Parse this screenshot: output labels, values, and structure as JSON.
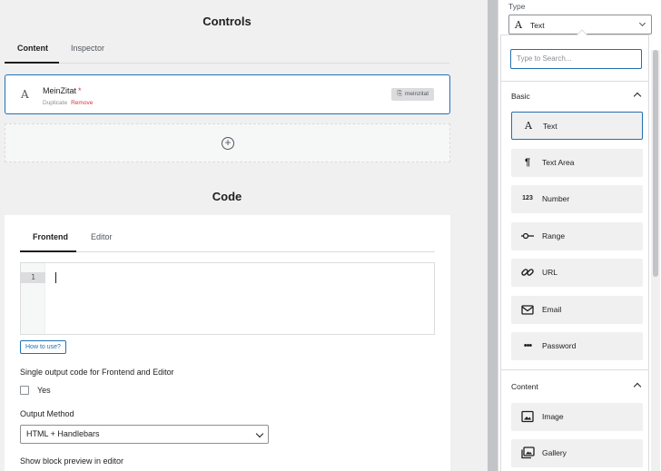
{
  "controls": {
    "title": "Controls",
    "tabs": [
      "Content",
      "Inspector"
    ],
    "items": [
      {
        "name": "MeinZitat",
        "required_mark": "*",
        "duplicate_label": "Duplicate",
        "remove_label": "Remove",
        "slug": "meinzitat",
        "icon": "text-a-icon"
      }
    ]
  },
  "code": {
    "title": "Code",
    "tabs": [
      "Frontend",
      "Editor"
    ],
    "line_number": "1",
    "howto_label": "How to use?",
    "single_output_label": "Single output code for Frontend and Editor",
    "yes_label": "Yes",
    "output_method_label": "Output Method",
    "output_method_value": "HTML + Handlebars",
    "preview_label": "Show block preview in editor"
  },
  "type_panel": {
    "label": "Type",
    "selected": "Text",
    "search_placeholder": "Type to Search...",
    "groups": [
      {
        "title": "Basic",
        "items": [
          {
            "label": "Text",
            "icon": "text-a-icon",
            "glyph": "A"
          },
          {
            "label": "Text Area",
            "icon": "pilcrow-icon",
            "glyph": "¶"
          },
          {
            "label": "Number",
            "icon": "number-123-icon",
            "glyph": "123"
          },
          {
            "label": "Range",
            "icon": "range-slider-icon",
            "glyph": "-o-"
          },
          {
            "label": "URL",
            "icon": "link-icon",
            "glyph": "link"
          },
          {
            "label": "Email",
            "icon": "envelope-icon",
            "glyph": "mail"
          },
          {
            "label": "Password",
            "icon": "password-dots-icon",
            "glyph": "•••"
          }
        ]
      },
      {
        "title": "Content",
        "items": [
          {
            "label": "Image",
            "icon": "image-icon",
            "glyph": "img"
          },
          {
            "label": "Gallery",
            "icon": "gallery-icon",
            "glyph": "gal"
          }
        ]
      }
    ]
  },
  "colors": {
    "accent": "#2271b1",
    "danger": "#d63638",
    "background": "#f0f0f1"
  }
}
